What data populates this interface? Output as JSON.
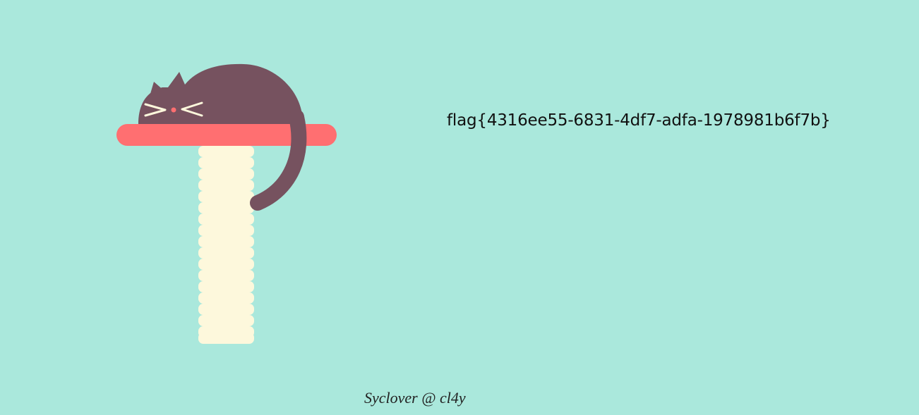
{
  "flag_text": "flag{4316ee55-6831-4df7-adfa-1978981b6f7b}",
  "credit_text": "Syclover @ cl4y",
  "scene": {
    "description_icon": "sleeping-cat-on-scratching-post",
    "colors": {
      "background": "#aae8dc",
      "cat": "#76525f",
      "shelf": "#ff6f71",
      "post": "#fdf8dc",
      "whiskers": "#fdf8dc",
      "nose": "#ff6f71"
    }
  }
}
